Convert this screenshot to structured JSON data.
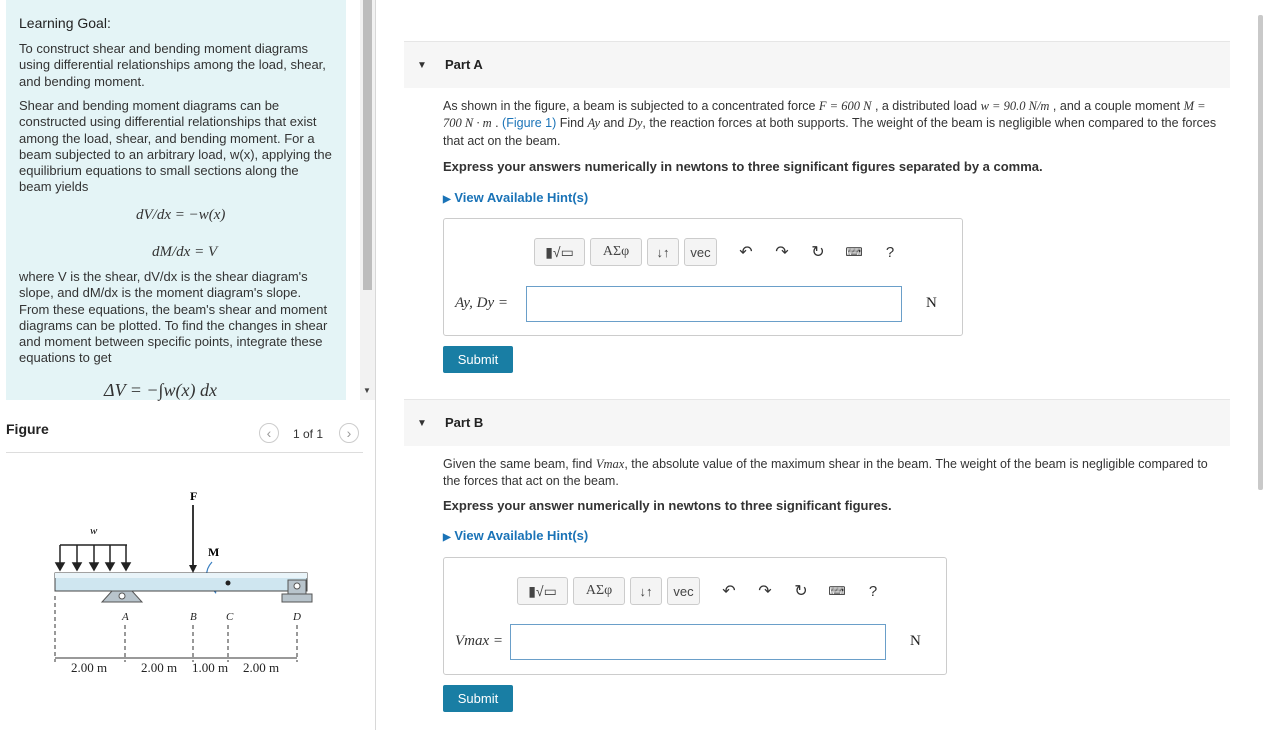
{
  "learning_goal": {
    "title": "Learning Goal:",
    "para1": "To construct shear and bending moment diagrams using differential relationships among the load, shear, and bending moment.",
    "para2": "Shear and bending moment diagrams can be constructed using differential relationships that exist among the load, shear, and bending moment. For a beam subjected to an arbitrary load, w(x), applying the equilibrium equations to small sections along the beam yields",
    "eq1": "dV/dx = −w(x)",
    "eq2": "dM/dx = V",
    "para3": "where V is the shear, dV/dx is the shear diagram's slope, and dM/dx is the moment diagram's slope. From these equations, the beam's shear and moment diagrams can be plotted. To find the changes in shear and moment between specific points, integrate these equations to get",
    "eq3": "ΔV = −∫w(x) dx"
  },
  "figure": {
    "title": "Figure",
    "pager": "1 of 1",
    "labels": {
      "F": "F",
      "w": "w",
      "M": "M",
      "A": "A",
      "B": "B",
      "C": "C",
      "D": "D"
    },
    "dims": [
      "2.00 m",
      "2.00 m",
      "1.00 m",
      "2.00 m"
    ]
  },
  "partA": {
    "label": "Part A",
    "text_pre": "As shown in the figure, a beam is subjected to a concentrated force ",
    "force": "F = 600 N",
    "text_mid1": " , a distributed load ",
    "load": "w = 90.0 N/m",
    "text_mid2": " , and a couple moment ",
    "moment": "M = 700 N · m",
    "text_mid3": " . ",
    "fig_link": "(Figure 1)",
    "text_mid4": " Find ",
    "ay": "Ay",
    "and": " and ",
    "dy": "Dy",
    "text_post": ", the reaction forces at both supports. The weight of the beam is negligible when compared to the forces that act on the beam.",
    "instruction": "Express your answers numerically in newtons to three significant figures separated by a comma.",
    "hint": "View Available Hint(s)",
    "input_label": "Ay, Dy =",
    "unit": "N",
    "submit": "Submit"
  },
  "partB": {
    "label": "Part B",
    "text_pre": "Given the same beam, find ",
    "vmax": "Vmax",
    "text_post": ", the absolute value of the maximum shear in the beam. The weight of the beam is negligible compared to the forces that act on the beam.",
    "instruction": "Express your answer numerically in newtons to three significant figures.",
    "hint": "View Available Hint(s)",
    "input_label": "Vmax =",
    "unit": "N",
    "submit": "Submit"
  },
  "toolbar": {
    "templates": "▮√▭",
    "greek": "ΑΣφ",
    "arrows": "↓↑",
    "vec": "vec",
    "help": "?"
  }
}
